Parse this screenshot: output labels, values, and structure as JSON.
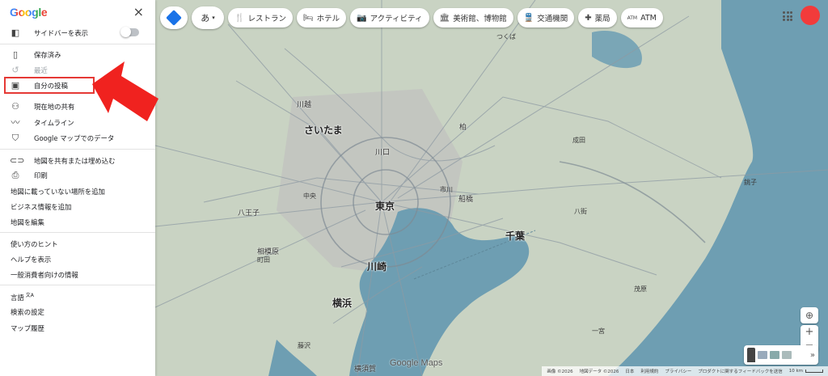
{
  "sidebar": {
    "logo": "Google",
    "close_label": "×",
    "items": [
      {
        "name": "show-sidebar",
        "label": "サイドバーを表示",
        "icon": "sidebar-icon"
      },
      {
        "name": "saved",
        "label": "保存済み",
        "icon": "bookmark-icon"
      },
      {
        "name": "recent",
        "label": "最近",
        "icon": "history-icon"
      },
      {
        "name": "my-contributions",
        "label": "自分の投稿",
        "icon": "contribution-icon"
      },
      {
        "name": "location-sharing",
        "label": "現在地の共有",
        "icon": "people-icon"
      },
      {
        "name": "timeline",
        "label": "タイムライン",
        "icon": "timeline-icon"
      },
      {
        "name": "your-data",
        "label": "Google マップでのデータ",
        "icon": "shield-icon"
      },
      {
        "name": "share-embed",
        "label": "地図を共有または埋め込む",
        "icon": "link-icon"
      },
      {
        "name": "print",
        "label": "印刷",
        "icon": "print-icon"
      },
      {
        "name": "add-missing-place",
        "label": "地図に載っていない場所を追加"
      },
      {
        "name": "add-business",
        "label": "ビジネス情報を追加"
      },
      {
        "name": "edit-map",
        "label": "地図を編集"
      },
      {
        "name": "tips",
        "label": "使い方のヒント"
      },
      {
        "name": "help",
        "label": "ヘルプを表示"
      },
      {
        "name": "consumer-info",
        "label": "一般消費者向けの情報"
      },
      {
        "name": "language",
        "label": "言語",
        "suffix": "文A"
      },
      {
        "name": "search-settings",
        "label": "検索の設定"
      },
      {
        "name": "maps-history",
        "label": "マップ履歴"
      }
    ]
  },
  "topbar": {
    "ime": "あ",
    "chips": [
      {
        "label": "レストラン",
        "icon": "restaurant-icon"
      },
      {
        "label": "ホテル",
        "icon": "hotel-icon"
      },
      {
        "label": "アクティビティ",
        "icon": "camera-icon"
      },
      {
        "label": "美術館、博物館",
        "icon": "museum-icon"
      },
      {
        "label": "交通機関",
        "icon": "transit-icon"
      },
      {
        "label": "薬局",
        "icon": "pharmacy-icon"
      },
      {
        "label": "ATM",
        "icon": "atm-icon"
      }
    ]
  },
  "map": {
    "cities": {
      "saitama": "さいたま",
      "tokyo": "東京",
      "chiba": "千葉",
      "kawasaki": "川崎",
      "yokohama": "横浜",
      "kawaguchi": "川口",
      "hachioji": "八王子",
      "funabashi": "船橋",
      "kawagoe": "川越",
      "kashiwa": "柏",
      "sagamihara": "相模原",
      "yokosuka": "横須賀",
      "tsukuba": "つくば",
      "choshi": "銚子",
      "narita": "成田",
      "ichikawa": "市川",
      "chuo": "中央",
      "machida": "町田",
      "yachimata": "八街",
      "mobara": "茂原",
      "chosei": "一宮",
      "fujisawa": "藤沢"
    },
    "logo": "Google Maps",
    "footer": {
      "imagery": "画像 ©2026",
      "mapdata": "地図データ ©2026",
      "region": "日本",
      "terms": "利用規約",
      "privacy": "プライバシー",
      "feedback": "プロダクトに関するフィードバックを送信",
      "scale": "10 km"
    }
  }
}
